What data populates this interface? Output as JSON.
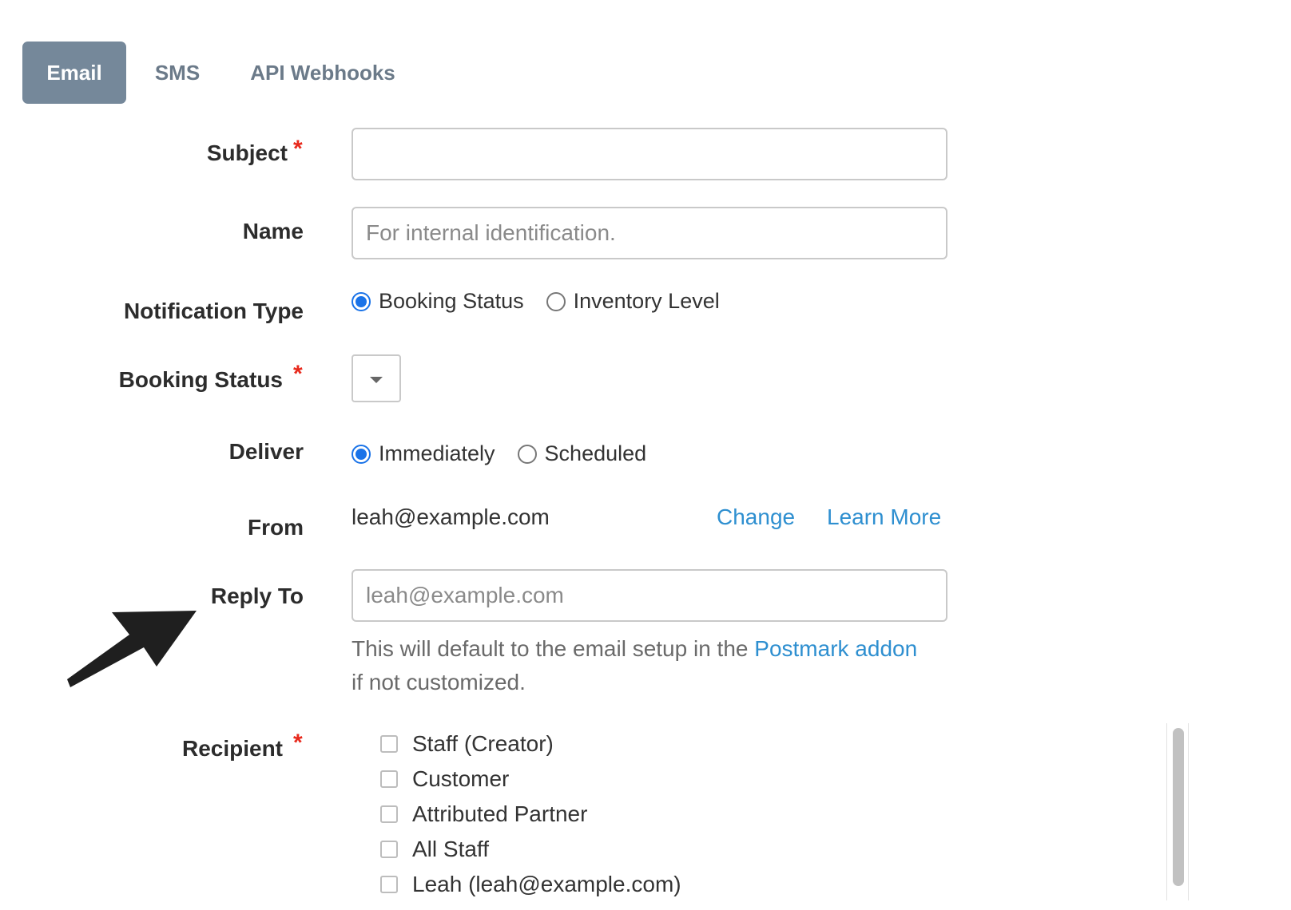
{
  "tabs": [
    {
      "label": "Email",
      "active": true
    },
    {
      "label": "SMS",
      "active": false
    },
    {
      "label": "API Webhooks",
      "active": false
    }
  ],
  "form": {
    "subject": {
      "label": "Subject",
      "value": "",
      "required": true
    },
    "name": {
      "label": "Name",
      "placeholder": "For internal identification.",
      "value": ""
    },
    "notification_type": {
      "label": "Notification Type",
      "options": [
        "Booking Status",
        "Inventory Level"
      ],
      "selected": "Booking Status"
    },
    "booking_status": {
      "label": "Booking Status",
      "required": true,
      "value": ""
    },
    "deliver": {
      "label": "Deliver",
      "options": [
        "Immediately",
        "Scheduled"
      ],
      "selected": "Immediately"
    },
    "from": {
      "label": "From",
      "value": "leah@example.com",
      "change_link": "Change",
      "learn_more_link": "Learn More"
    },
    "reply_to": {
      "label": "Reply To",
      "placeholder": "leah@example.com",
      "help_prefix": "This will default to the email setup in the ",
      "help_link": "Postmark addon",
      "help_suffix": "if not customized."
    },
    "recipient": {
      "label": "Recipient",
      "required": true,
      "options": [
        "Staff (Creator)",
        "Customer",
        "Attributed Partner",
        "All Staff",
        "Leah (leah@example.com)"
      ]
    },
    "required_mark": "*"
  },
  "colors": {
    "active_tab": "#75889a",
    "link": "#2e8fd0",
    "required": "#e8291c",
    "radio_selected": "#1a73e8"
  }
}
